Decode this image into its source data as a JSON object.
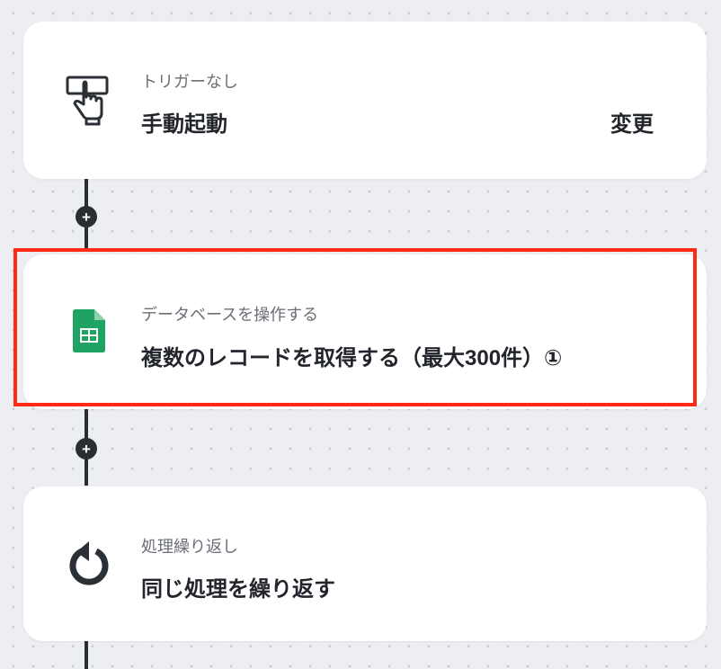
{
  "flow": {
    "steps": [
      {
        "category": "トリガーなし",
        "title": "手動起動",
        "action_label": "変更",
        "icon": "hand-pointer-icon"
      },
      {
        "category": "データベースを操作する",
        "title": "複数のレコードを取得する（最大300件）①",
        "icon": "google-sheets-icon"
      },
      {
        "category": "処理繰り返し",
        "title": "同じ処理を繰り返す",
        "icon": "loop-icon"
      }
    ],
    "add_step_symbol": "+"
  },
  "colors": {
    "background": "#eceef2",
    "card": "#ffffff",
    "connector": "#2a2d33",
    "highlight": "#ff2a14",
    "sheets_green": "#1ea362"
  }
}
